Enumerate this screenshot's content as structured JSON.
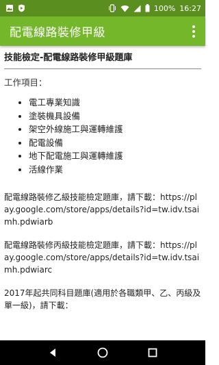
{
  "status_bar": {
    "battery_percent": "100%",
    "time": "16:27",
    "icons": [
      "image-icon",
      "shield-icon",
      "vibrate-icon",
      "wifi-icon",
      "signal-icon",
      "battery-icon"
    ]
  },
  "app_bar": {
    "title": "配電線路裝修甲級",
    "menu_icon": "overflow-menu-icon"
  },
  "content": {
    "section_title": "技能檢定-配電線路裝修甲級題庫",
    "intro": "工作項目：",
    "items": [
      "電工專業知識",
      "塗裝機具設備",
      "架空外線施工與運轉維護",
      "配電設備",
      "地下配電施工與運轉維護",
      "活線作業"
    ],
    "para1": "配電線路裝修乙級技能檢定題庫，請下載：https://play.google.com/store/apps/details?id=tw.idv.tsaimh.pdwiarb",
    "para2": "配電線路裝修丙級技能檢定題庫，請下載：https://play.google.com/store/apps/details?id=tw.idv.tsaimh.pdwiarc",
    "para3": "2017年起共同科目題庫(適用於各職類甲、乙、丙級及單一級)，請下載："
  },
  "nav_bar": {
    "icons": [
      "back-icon",
      "home-icon",
      "recents-icon"
    ]
  },
  "colors": {
    "status_bar": "#5a8f1f",
    "app_bar": "#74b72b",
    "nav_bar": "#000000"
  }
}
